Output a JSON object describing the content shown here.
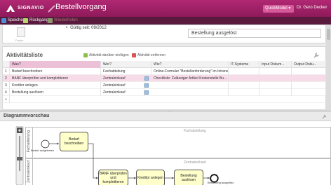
{
  "app": {
    "brand": "SIGNAVIO",
    "doc_title": "Bestellvorgang",
    "quickmodel_label": "QuickModel",
    "user_name": "Dr. Gero Decker"
  },
  "toolbar": {
    "items": [
      {
        "label": "Speichern",
        "color": "#4a8fd8",
        "enabled": true
      },
      {
        "label": "Rückgang",
        "color": "#b9d86a",
        "enabled": true
      },
      {
        "label": "Wiederholen",
        "color": "#b9d86a",
        "enabled": false
      }
    ]
  },
  "details": {
    "doc_icon_label": "Papier",
    "valid_text": "Gültig seit: 09/2012",
    "result_value": "Bestellung ausgelöst"
  },
  "activity_list": {
    "title": "Aktivitätsliste",
    "insert_label": "Aktivität darüber einfügen",
    "remove_label": "Aktivität entfernen",
    "columns": [
      "Was?",
      "Wer?",
      "Wie?",
      "IT-Systeme",
      "Input Dokum...",
      "Output Doku..."
    ],
    "rows": [
      {
        "num": "1",
        "was": "Bedarf beschreiben",
        "wer": "Fachabteilung",
        "wie": "Online-Formular \"Bestellanforderung\" im Intranet",
        "has_icon": false
      },
      {
        "num": "2",
        "was": "BANF überprüfen und komplettieren",
        "wer": "Zentraleinkauf",
        "wie": "Checkliste: Zulässiger Artikel Kostenstelle Bu...",
        "has_icon": true
      },
      {
        "num": "3",
        "was": "Kreditor anlegen",
        "wer": "Zentraleinkauf",
        "wie": "",
        "has_icon": true
      },
      {
        "num": "4",
        "was": "Bestellung auslösen",
        "wer": "Zentraleinkauf",
        "wie": "",
        "has_icon": true
      },
      {
        "num": "+",
        "was": "",
        "wer": "",
        "wie": "",
        "has_icon": false
      }
    ]
  },
  "diagram": {
    "title": "Diagrammvorschau",
    "lanes": [
      {
        "label": "Fachabteilung",
        "top_label": "Fachabteilung"
      },
      {
        "label": "Zentraleinkauf",
        "top_label": "Zentraleinkauf"
      }
    ],
    "start_event": "Bedarf aufgetreten",
    "end_event": "Bestellung ausgelöst",
    "tasks": [
      {
        "label": "Bedarf beschreiben"
      },
      {
        "label": "BANF überprüfen und komplettieren"
      },
      {
        "label": "Kreditor anlegen"
      },
      {
        "label": "Bestellung auslösen"
      }
    ]
  }
}
